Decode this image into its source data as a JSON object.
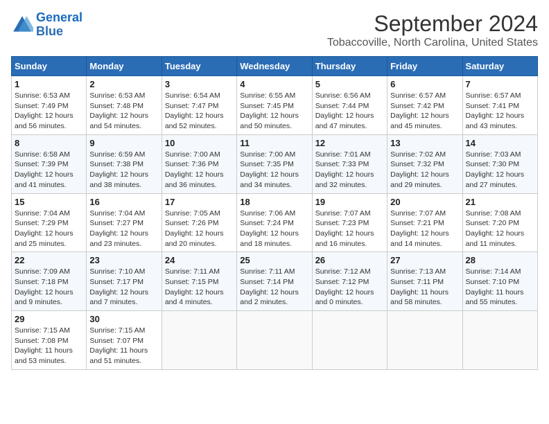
{
  "header": {
    "logo_line1": "General",
    "logo_line2": "Blue",
    "title": "September 2024",
    "subtitle": "Tobaccoville, North Carolina, United States"
  },
  "weekdays": [
    "Sunday",
    "Monday",
    "Tuesday",
    "Wednesday",
    "Thursday",
    "Friday",
    "Saturday"
  ],
  "weeks": [
    [
      {
        "day": "1",
        "sunrise": "6:53 AM",
        "sunset": "7:49 PM",
        "daylight": "12 hours and 56 minutes."
      },
      {
        "day": "2",
        "sunrise": "6:53 AM",
        "sunset": "7:48 PM",
        "daylight": "12 hours and 54 minutes."
      },
      {
        "day": "3",
        "sunrise": "6:54 AM",
        "sunset": "7:47 PM",
        "daylight": "12 hours and 52 minutes."
      },
      {
        "day": "4",
        "sunrise": "6:55 AM",
        "sunset": "7:45 PM",
        "daylight": "12 hours and 50 minutes."
      },
      {
        "day": "5",
        "sunrise": "6:56 AM",
        "sunset": "7:44 PM",
        "daylight": "12 hours and 47 minutes."
      },
      {
        "day": "6",
        "sunrise": "6:57 AM",
        "sunset": "7:42 PM",
        "daylight": "12 hours and 45 minutes."
      },
      {
        "day": "7",
        "sunrise": "6:57 AM",
        "sunset": "7:41 PM",
        "daylight": "12 hours and 43 minutes."
      }
    ],
    [
      {
        "day": "8",
        "sunrise": "6:58 AM",
        "sunset": "7:39 PM",
        "daylight": "12 hours and 41 minutes."
      },
      {
        "day": "9",
        "sunrise": "6:59 AM",
        "sunset": "7:38 PM",
        "daylight": "12 hours and 38 minutes."
      },
      {
        "day": "10",
        "sunrise": "7:00 AM",
        "sunset": "7:36 PM",
        "daylight": "12 hours and 36 minutes."
      },
      {
        "day": "11",
        "sunrise": "7:00 AM",
        "sunset": "7:35 PM",
        "daylight": "12 hours and 34 minutes."
      },
      {
        "day": "12",
        "sunrise": "7:01 AM",
        "sunset": "7:33 PM",
        "daylight": "12 hours and 32 minutes."
      },
      {
        "day": "13",
        "sunrise": "7:02 AM",
        "sunset": "7:32 PM",
        "daylight": "12 hours and 29 minutes."
      },
      {
        "day": "14",
        "sunrise": "7:03 AM",
        "sunset": "7:30 PM",
        "daylight": "12 hours and 27 minutes."
      }
    ],
    [
      {
        "day": "15",
        "sunrise": "7:04 AM",
        "sunset": "7:29 PM",
        "daylight": "12 hours and 25 minutes."
      },
      {
        "day": "16",
        "sunrise": "7:04 AM",
        "sunset": "7:27 PM",
        "daylight": "12 hours and 23 minutes."
      },
      {
        "day": "17",
        "sunrise": "7:05 AM",
        "sunset": "7:26 PM",
        "daylight": "12 hours and 20 minutes."
      },
      {
        "day": "18",
        "sunrise": "7:06 AM",
        "sunset": "7:24 PM",
        "daylight": "12 hours and 18 minutes."
      },
      {
        "day": "19",
        "sunrise": "7:07 AM",
        "sunset": "7:23 PM",
        "daylight": "12 hours and 16 minutes."
      },
      {
        "day": "20",
        "sunrise": "7:07 AM",
        "sunset": "7:21 PM",
        "daylight": "12 hours and 14 minutes."
      },
      {
        "day": "21",
        "sunrise": "7:08 AM",
        "sunset": "7:20 PM",
        "daylight": "12 hours and 11 minutes."
      }
    ],
    [
      {
        "day": "22",
        "sunrise": "7:09 AM",
        "sunset": "7:18 PM",
        "daylight": "12 hours and 9 minutes."
      },
      {
        "day": "23",
        "sunrise": "7:10 AM",
        "sunset": "7:17 PM",
        "daylight": "12 hours and 7 minutes."
      },
      {
        "day": "24",
        "sunrise": "7:11 AM",
        "sunset": "7:15 PM",
        "daylight": "12 hours and 4 minutes."
      },
      {
        "day": "25",
        "sunrise": "7:11 AM",
        "sunset": "7:14 PM",
        "daylight": "12 hours and 2 minutes."
      },
      {
        "day": "26",
        "sunrise": "7:12 AM",
        "sunset": "7:12 PM",
        "daylight": "12 hours and 0 minutes."
      },
      {
        "day": "27",
        "sunrise": "7:13 AM",
        "sunset": "7:11 PM",
        "daylight": "11 hours and 58 minutes."
      },
      {
        "day": "28",
        "sunrise": "7:14 AM",
        "sunset": "7:10 PM",
        "daylight": "11 hours and 55 minutes."
      }
    ],
    [
      {
        "day": "29",
        "sunrise": "7:15 AM",
        "sunset": "7:08 PM",
        "daylight": "11 hours and 53 minutes."
      },
      {
        "day": "30",
        "sunrise": "7:15 AM",
        "sunset": "7:07 PM",
        "daylight": "11 hours and 51 minutes."
      },
      null,
      null,
      null,
      null,
      null
    ]
  ]
}
